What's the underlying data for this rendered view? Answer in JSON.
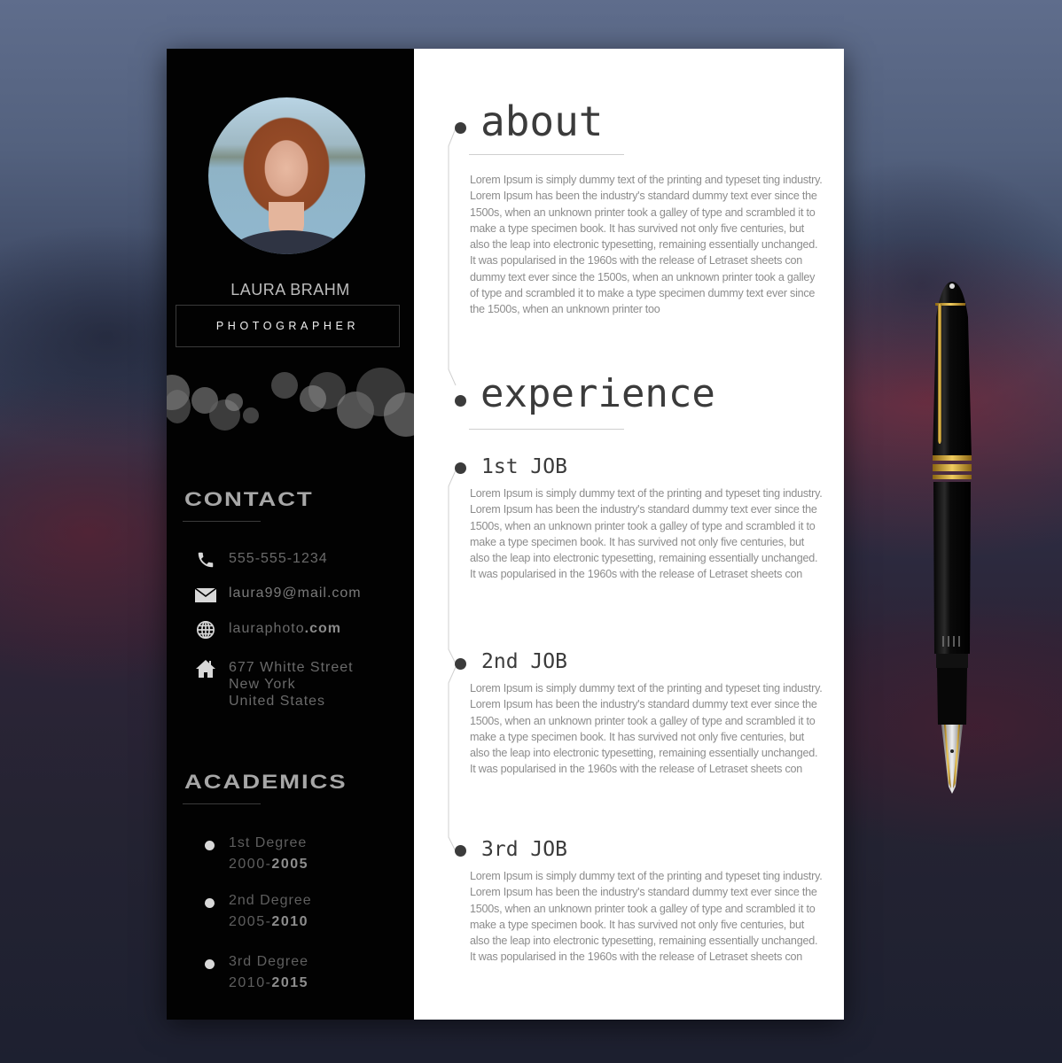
{
  "profile": {
    "name": "LAURA BRAHM",
    "title": "PHOTOGRAPHER"
  },
  "contact": {
    "heading": "CONTACT",
    "phone": "555-555-1234",
    "email": "laura99@mail.com",
    "website_prefix": "lauraphoto",
    "website_suffix": ".com",
    "address_line1": "677 Whitte Street",
    "address_line2": "New York",
    "address_line3": "United States",
    "icons": [
      "phone-icon",
      "mail-icon",
      "globe-icon",
      "home-icon"
    ]
  },
  "academics": {
    "heading": "ACADEMICS",
    "items": [
      {
        "label": "1st Degree",
        "start": "2000-",
        "end": "2005"
      },
      {
        "label": "2nd Degree",
        "start": "2005-",
        "end": "2010"
      },
      {
        "label": "3rd Degree",
        "start": "2010-",
        "end": "2015"
      }
    ]
  },
  "about": {
    "heading": "about",
    "text": "Lorem Ipsum is simply dummy text of the printing and typeset ting industry. Lorem Ipsum has been the industry's standard dummy text ever since the 1500s, when an unknown printer took a galley of type and scrambled it to make a type specimen book. It has survived not only five centuries, but also the leap into electronic typesetting, remaining essentially unchanged. It was popularised in the 1960s with the release of Letraset sheets con dummy text ever since the 1500s, when an unknown printer took a galley of type and scrambled it to make a type specimen dummy text ever since the 1500s, when an unknown printer too"
  },
  "experience": {
    "heading": "experience",
    "jobs": [
      {
        "title": "1st JOB",
        "text": "Lorem Ipsum is simply dummy text of the printing and typeset ting industry. Lorem Ipsum has been the industry's standard dummy text ever since the 1500s, when an unknown printer took a galley of type and scrambled it to make a type specimen book. It has survived not only five centuries, but also the leap into electronic typesetting, remaining essentially unchanged. It was popularised in the 1960s with the release of Letraset sheets con"
      },
      {
        "title": "2nd JOB",
        "text": "Lorem Ipsum is simply dummy text of the printing and typeset ting industry. Lorem Ipsum has been the industry's standard dummy text ever since the 1500s, when an unknown printer took a galley of type and scrambled it to make a type specimen book. It has survived not only five centuries, but also the leap into electronic typesetting, remaining essentially unchanged. It was popularised in the 1960s with the release of Letraset sheets con"
      },
      {
        "title": "3rd JOB",
        "text": "Lorem Ipsum is simply dummy text of the printing and typeset ting industry. Lorem Ipsum has been the industry's standard dummy text ever since the 1500s, when an unknown printer took a galley of type and scrambled it to make a type specimen book. It has survived not only five centuries, but also the leap into electronic typesetting, remaining essentially unchanged. It was popularised in the 1960s with the release of Letraset sheets con"
      }
    ]
  },
  "colors": {
    "sidebar_bg": "#020202",
    "main_bg": "#ffffff",
    "heading_dark": "#3b3b3b",
    "body_text": "#8c8c8c",
    "sidebar_heading": "#a7a7a7"
  }
}
